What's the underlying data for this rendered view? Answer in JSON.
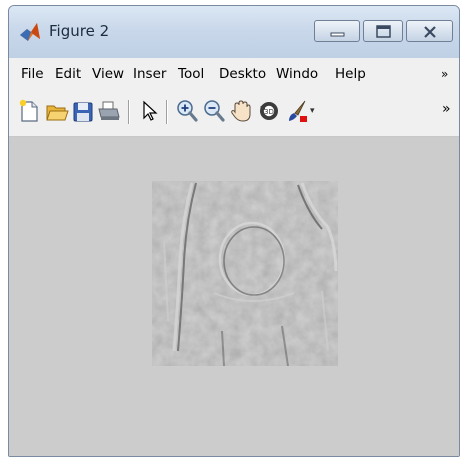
{
  "window": {
    "title": "Figure 2",
    "controls": {
      "minimize": "minimize",
      "maximize": "maximize",
      "close": "close"
    }
  },
  "menubar": {
    "items": [
      {
        "label": "File"
      },
      {
        "label": "Edit"
      },
      {
        "label": "View"
      },
      {
        "label": "Inser"
      },
      {
        "label": "Tool"
      },
      {
        "label": "Deskto"
      },
      {
        "label": "Windo"
      },
      {
        "label": "Help"
      }
    ],
    "overflow_label": "»"
  },
  "toolbar": {
    "buttons": [
      "new-figure-icon",
      "open-file-icon",
      "save-icon",
      "print-icon",
      "pointer-icon",
      "zoom-in-icon",
      "zoom-out-icon",
      "pan-hand-icon",
      "rotate-3d-icon",
      "data-brush-icon"
    ],
    "overflow_label": "»"
  },
  "colors": {
    "canvas": "#cccccc",
    "titlebar": "#c9d8ea",
    "menubar": "#f0f0f0"
  }
}
